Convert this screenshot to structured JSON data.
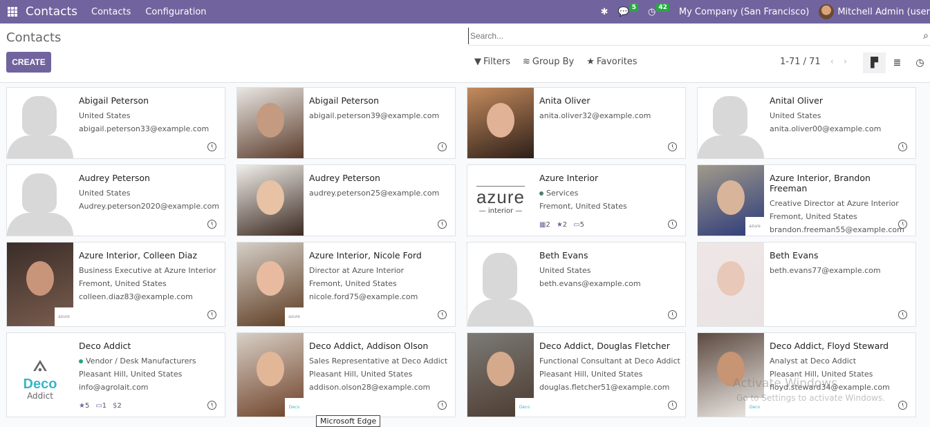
{
  "navbar": {
    "brand": "Contacts",
    "menu": [
      "Contacts",
      "Configuration"
    ],
    "messages_count": "5",
    "activities_count": "42",
    "company": "My Company (San Francisco)",
    "user": "Mitchell Admin (user"
  },
  "control": {
    "title": "Contacts",
    "create_label": "CREATE",
    "search_placeholder": "Search...",
    "filters_label": "Filters",
    "groupby_label": "Group By",
    "favorites_label": "Favorites",
    "pager": "1-71 / 71"
  },
  "cards": [
    {
      "name": "Abigail Peterson",
      "lines": [
        "United States",
        "abigail.peterson33@example.com"
      ],
      "image": "placeholder"
    },
    {
      "name": "Abigail Peterson",
      "lines": [
        "abigail.peterson39@example.com"
      ],
      "image": "photo"
    },
    {
      "name": "Anita Oliver",
      "lines": [
        "anita.oliver32@example.com"
      ],
      "image": "photo"
    },
    {
      "name": "Anital Oliver",
      "lines": [
        "United States",
        "anita.oliver00@example.com"
      ],
      "image": "placeholder"
    },
    {
      "name": "Audrey Peterson",
      "lines": [
        "United States",
        "Audrey.peterson2020@example.com"
      ],
      "image": "placeholder"
    },
    {
      "name": "Audrey Peterson",
      "lines": [
        "audrey.peterson25@example.com"
      ],
      "image": "photo"
    },
    {
      "name": "Azure Interior",
      "tag": "Services",
      "tag_color": "#4a7f6e",
      "lines": [
        "Fremont, United States"
      ],
      "image": "azure",
      "stats": [
        "2",
        "2",
        "5"
      ]
    },
    {
      "name": "Azure Interior, Brandon Freeman",
      "lines": [
        "Creative Director at Azure Interior",
        "Fremont, United States",
        "brandon.freeman55@example.com"
      ],
      "image": "photo",
      "company_logo": "azure"
    },
    {
      "name": "Azure Interior, Colleen Diaz",
      "lines": [
        "Business Executive at Azure Interior",
        "Fremont, United States",
        "colleen.diaz83@example.com"
      ],
      "image": "photo",
      "company_logo": "azure"
    },
    {
      "name": "Azure Interior, Nicole Ford",
      "lines": [
        "Director at Azure Interior",
        "Fremont, United States",
        "nicole.ford75@example.com"
      ],
      "image": "photo",
      "company_logo": "azure"
    },
    {
      "name": "Beth Evans",
      "lines": [
        "United States",
        "beth.evans@example.com"
      ],
      "image": "placeholder"
    },
    {
      "name": "Beth Evans",
      "lines": [
        "beth.evans77@example.com"
      ],
      "image": "photo"
    },
    {
      "name": "Deco Addict",
      "tag": "Vendor / Desk Manufacturers",
      "tag_color": "#21a67a",
      "lines": [
        "Pleasant Hill, United States",
        "info@agrolait.com"
      ],
      "image": "deco",
      "stats": [
        "5",
        "1",
        "2"
      ]
    },
    {
      "name": "Deco Addict, Addison Olson",
      "lines": [
        "Sales Representative at Deco Addict",
        "Pleasant Hill, United States",
        "addison.olson28@example.com"
      ],
      "image": "photo",
      "company_logo": "deco"
    },
    {
      "name": "Deco Addict, Douglas Fletcher",
      "lines": [
        "Functional Consultant at Deco Addict",
        "Pleasant Hill, United States",
        "douglas.fletcher51@example.com"
      ],
      "image": "photo",
      "company_logo": "deco"
    },
    {
      "name": "Deco Addict, Floyd Steward",
      "lines": [
        "Analyst at Deco Addict",
        "Pleasant Hill, United States",
        "floyd.steward34@example.com"
      ],
      "image": "photo",
      "company_logo": "deco"
    }
  ],
  "logos": {
    "azure_word": "azure",
    "azure_sub": "interior",
    "deco_word": "Deco",
    "deco_sub": "Addict"
  },
  "overlay": {
    "tooltip": "Microsoft Edge",
    "watermark_title": "Activate Windows",
    "watermark_sub": "Go to Settings to activate Windows."
  }
}
